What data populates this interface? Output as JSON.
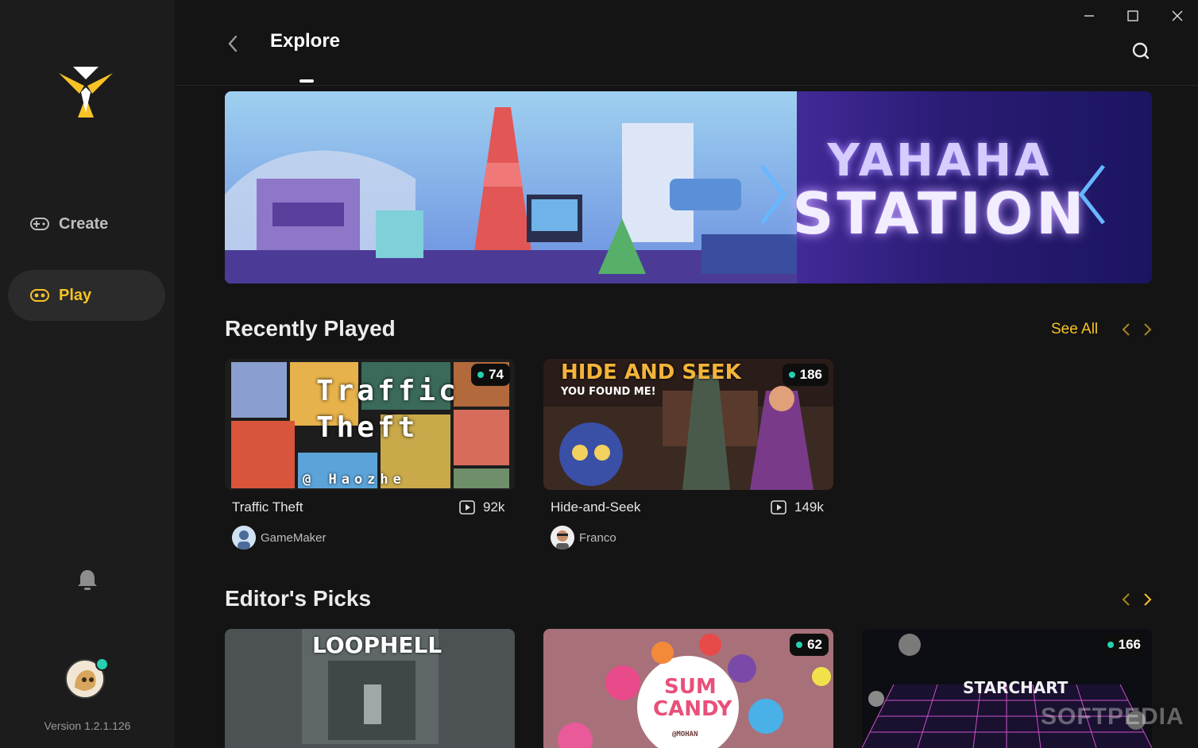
{
  "app": {
    "version": "Version 1.2.1.126",
    "brand_color": "#f7c327",
    "accent_online": "#26d0b1"
  },
  "sidebar": {
    "items": [
      {
        "label": "Create",
        "icon": "gamepad-plus-icon",
        "active": false
      },
      {
        "label": "Play",
        "icon": "gamepad-icon",
        "active": true
      }
    ],
    "notification_icon": "bell-icon"
  },
  "header": {
    "title": "Explore",
    "back_icon": "chevron-left-icon",
    "search_icon": "search-icon"
  },
  "window_controls": [
    "minimize-icon",
    "maximize-icon",
    "close-icon"
  ],
  "banner": {
    "line1": "YAHAHA",
    "line2": "STATION"
  },
  "recently_played": {
    "title": "Recently Played",
    "see_all": "See All",
    "cards": [
      {
        "name": "Traffic Theft",
        "online": "74",
        "plays": "92k",
        "author": "GameMaker",
        "thumb_line1": "Traffic",
        "thumb_line2": "Theft",
        "thumb_credit": "@ Haozhe"
      },
      {
        "name": "Hide-and-Seek",
        "online": "186",
        "plays": "149k",
        "author": "Franco",
        "thumb_line1": "HIDE AND SEEK",
        "thumb_line2": "YOU FOUND ME!"
      }
    ]
  },
  "editors_picks": {
    "title": "Editor's Picks",
    "cards": [
      {
        "thumb_text": "LOOPHELL"
      },
      {
        "online": "62",
        "thumb_line1": "SUM",
        "thumb_line2": "CANDY",
        "thumb_credit": "@MOHAN"
      },
      {
        "online": "166",
        "thumb_text": "STARCHART"
      }
    ]
  },
  "watermark": "SOFTPEDIA"
}
